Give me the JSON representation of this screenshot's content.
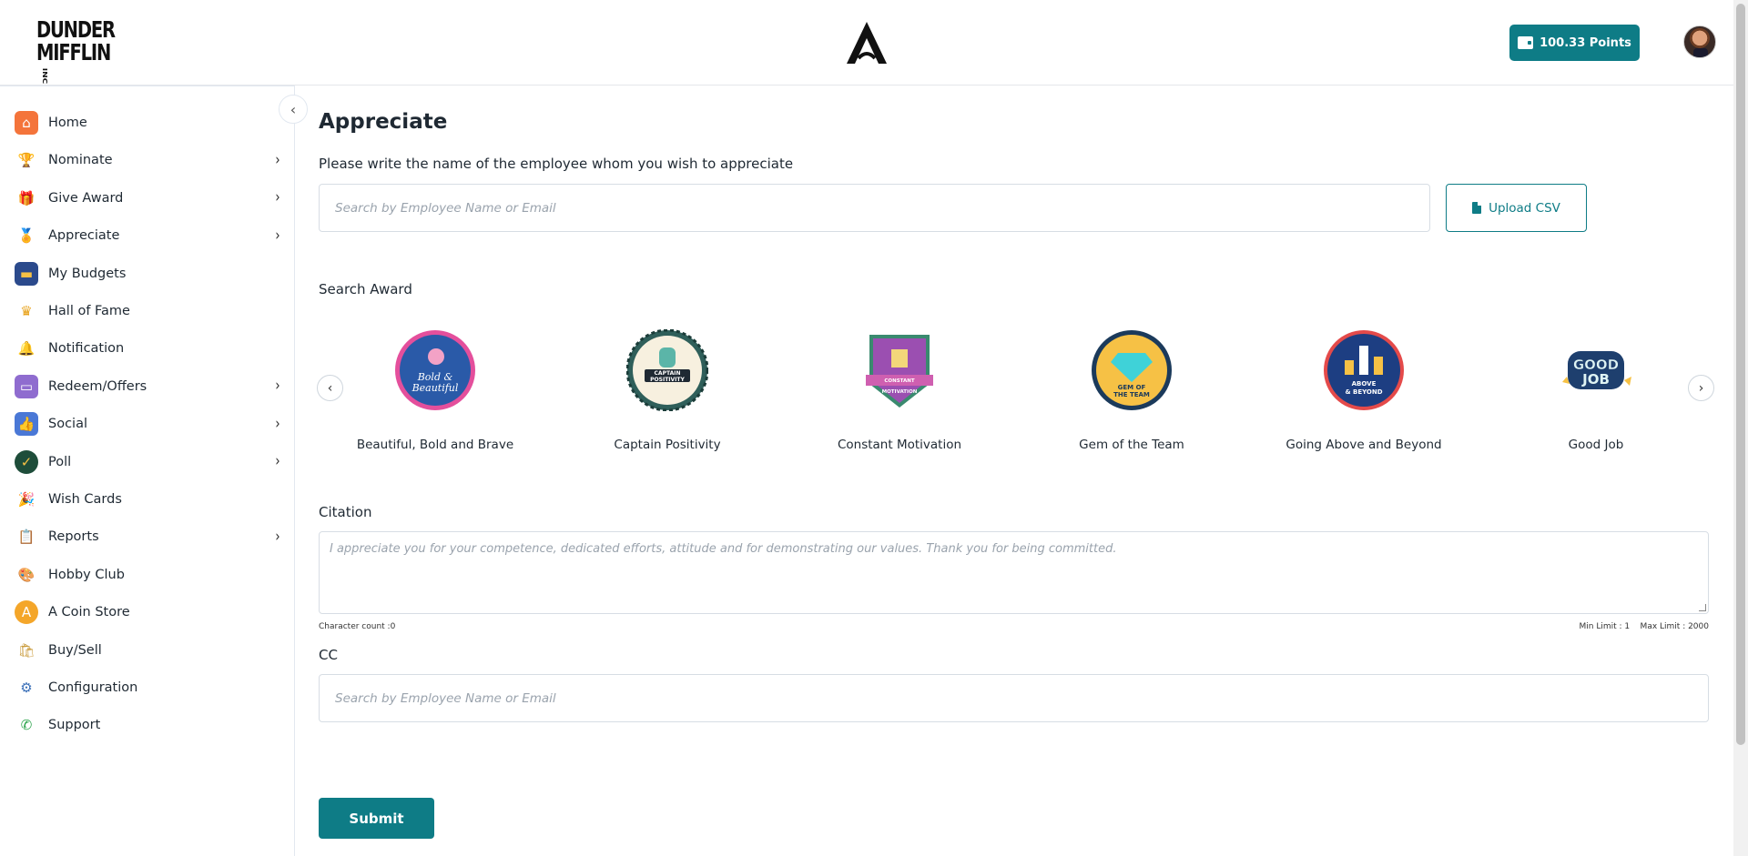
{
  "header": {
    "logo_line1": "DUNDER",
    "logo_line2": "MIFFLIN",
    "logo_suffix": "INC",
    "points_label": "100.33  Points"
  },
  "sidebar": {
    "items": [
      {
        "label": "Home",
        "icon": "home-icon",
        "has_chevron": false
      },
      {
        "label": "Nominate",
        "icon": "trophy-icon",
        "has_chevron": true
      },
      {
        "label": "Give Award",
        "icon": "gift-icon",
        "has_chevron": true
      },
      {
        "label": "Appreciate",
        "icon": "medal-icon",
        "has_chevron": true
      },
      {
        "label": "My Budgets",
        "icon": "wallet-icon",
        "has_chevron": false
      },
      {
        "label": "Hall of Fame",
        "icon": "crown-icon",
        "has_chevron": false
      },
      {
        "label": "Notification",
        "icon": "bell-icon",
        "has_chevron": false
      },
      {
        "label": "Redeem/Offers",
        "icon": "coupon-icon",
        "has_chevron": true
      },
      {
        "label": "Social",
        "icon": "like-icon",
        "has_chevron": true
      },
      {
        "label": "Poll",
        "icon": "poll-icon",
        "has_chevron": true
      },
      {
        "label": "Wish Cards",
        "icon": "party-popper-icon",
        "has_chevron": false
      },
      {
        "label": "Reports",
        "icon": "clipboard-icon",
        "has_chevron": true
      },
      {
        "label": "Hobby Club",
        "icon": "palette-icon",
        "has_chevron": false
      },
      {
        "label": "A Coin Store",
        "icon": "coin-icon",
        "has_chevron": false
      },
      {
        "label": "Buy/Sell",
        "icon": "shopping-bags-icon",
        "has_chevron": false
      },
      {
        "label": "Configuration",
        "icon": "settings-monitor-icon",
        "has_chevron": false
      },
      {
        "label": "Support",
        "icon": "phone-icon",
        "has_chevron": false
      }
    ]
  },
  "main": {
    "title": "Appreciate",
    "instruction": "Please write the name of the employee whom you wish to appreciate",
    "search_placeholder": "Search by Employee Name or Email",
    "upload_label": "Upload CSV",
    "search_award_label": "Search Award",
    "awards": [
      {
        "name": "Beautiful, Bold and Brave",
        "badge_text": "Bold & Beautiful"
      },
      {
        "name": "Captain Positivity",
        "badge_text": "CAPTAIN POSITIVITY"
      },
      {
        "name": "Constant Motivation",
        "badge_text": "CONSTANT MOTIVATION"
      },
      {
        "name": "Gem of the Team",
        "badge_text": "GEM OF THE TEAM"
      },
      {
        "name": "Going Above and Beyond",
        "badge_text": "ABOVE & BEYOND"
      },
      {
        "name": "Good Job",
        "badge_text": "GOOD JOB"
      }
    ],
    "citation_label": "Citation",
    "citation_placeholder": "I appreciate you for your competence, dedicated efforts, attitude and for demonstrating our values. Thank you for being committed.",
    "character_count": "Character count :0",
    "limits": "Min Limit : 1    Max Limit : 2000",
    "cc_label": "CC",
    "cc_placeholder": "Search by Employee Name or Email",
    "submit_label": "Submit"
  },
  "colors": {
    "accent": "#0e7c86"
  }
}
